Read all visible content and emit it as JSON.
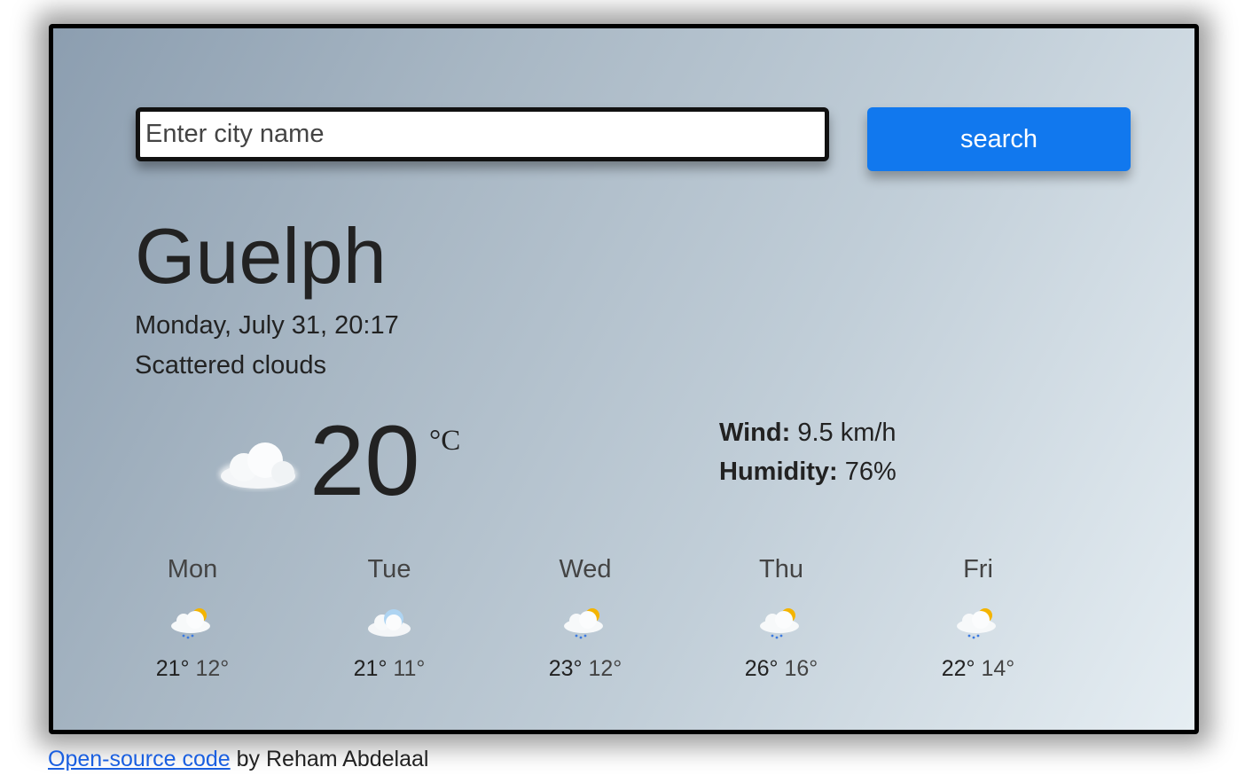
{
  "search": {
    "placeholder": "Enter city name",
    "button_label": "search"
  },
  "current": {
    "city": "Guelph",
    "datetime": "Monday, July 31, 20:17",
    "description": "Scattered clouds",
    "temperature": "20",
    "unit": "°C",
    "icon": "cloud-icon",
    "wind_label": "Wind:",
    "wind_value": "9.5 km/h",
    "humidity_label": "Humidity:",
    "humidity_value": "76%"
  },
  "forecast": [
    {
      "day": "Mon",
      "high": "21°",
      "low": "12°",
      "icon": "sun-cloud-rain-icon"
    },
    {
      "day": "Tue",
      "high": "21°",
      "low": "11°",
      "icon": "cloud-icon"
    },
    {
      "day": "Wed",
      "high": "23°",
      "low": "12°",
      "icon": "sun-cloud-rain-icon"
    },
    {
      "day": "Thu",
      "high": "26°",
      "low": "16°",
      "icon": "sun-cloud-rain-icon"
    },
    {
      "day": "Fri",
      "high": "22°",
      "low": "14°",
      "icon": "sun-cloud-rain-icon"
    }
  ],
  "footer": {
    "link_text": "Open-source code",
    "suffix": " by Reham Abdelaal"
  },
  "colors": {
    "accent": "#1178ee",
    "sun": "#f4b400",
    "rain": "#3b7ae0"
  }
}
